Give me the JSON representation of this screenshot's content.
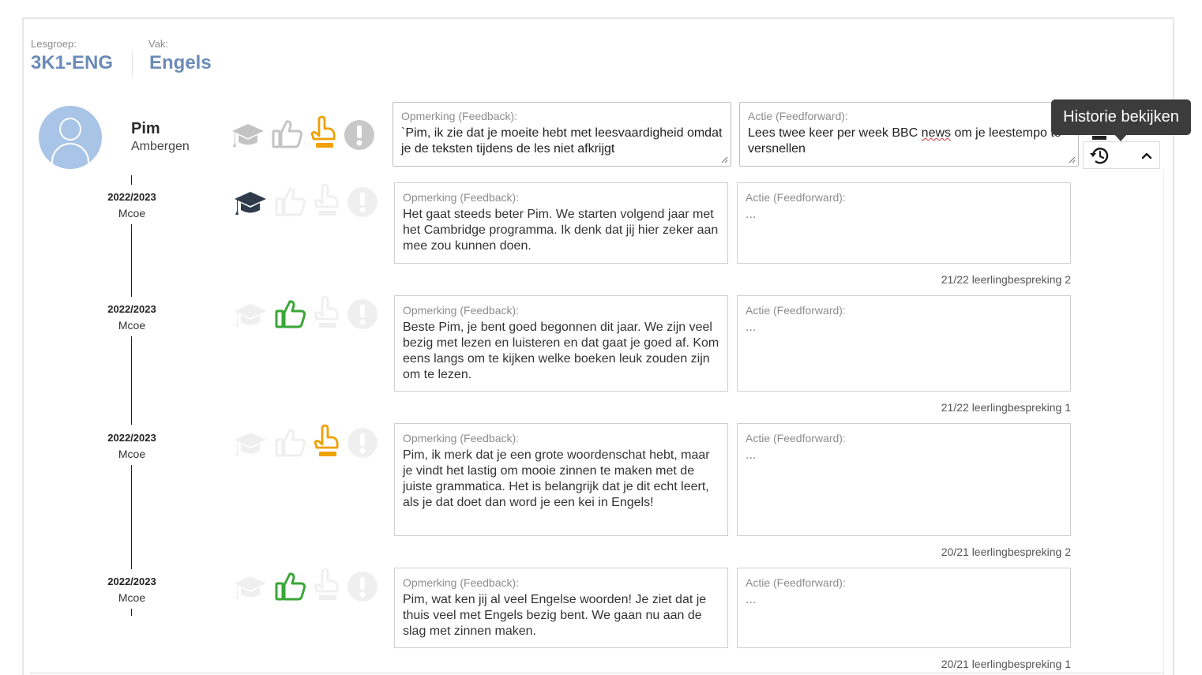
{
  "header": {
    "group_label": "Lesgroep:",
    "group_value": "3K1-ENG",
    "subject_label": "Vak:",
    "subject_value": "Engels"
  },
  "student": {
    "first_name": "Pim",
    "last_name": "Ambergen"
  },
  "current": {
    "feedback_label": "Opmerking (Feedback):",
    "feedback_text": "`Pim, ik zie dat je moeite hebt met leesvaardigheid omdat je de teksten tijdens de les niet afkrijgt",
    "feedforward_label": "Actie (Feedforward):",
    "feedforward_pre": "Lees twee keer per week BBC ",
    "feedforward_misspelled": "news",
    "feedforward_post": " om je leestempo te versnellen",
    "selected_status": "attention",
    "status_color": "#f0a000"
  },
  "tooltip": {
    "text": "Historie bekijken"
  },
  "actions": {
    "history_icon": "history-icon",
    "collapse_icon": "chevron-up-icon"
  },
  "history": [
    {
      "year": "2022/2023",
      "teacher": "Mcoe",
      "status": "excellent",
      "feedback_label": "Opmerking (Feedback):",
      "feedback_text": "Het gaat steeds beter Pim. We starten volgend jaar met het Cambridge programma. Ik denk dat jij hier zeker aan mee zou kunnen doen.",
      "feedforward_label": "Actie (Feedforward):",
      "feedforward_text": "...",
      "meeting": "21/22 leerlingbespreking 2"
    },
    {
      "year": "2022/2023",
      "teacher": "Mcoe",
      "status": "good",
      "feedback_label": "Opmerking (Feedback):",
      "feedback_text": "Beste Pim, je bent goed begonnen dit jaar. We zijn veel bezig met lezen en luisteren en dat gaat je goed af. Kom eens langs om te kijken welke boeken leuk zouden zijn om te lezen.",
      "feedforward_label": "Actie (Feedforward):",
      "feedforward_text": "...",
      "meeting": "21/22 leerlingbespreking 1"
    },
    {
      "year": "2022/2023",
      "teacher": "Mcoe",
      "status": "attention",
      "feedback_label": "Opmerking (Feedback):",
      "feedback_text": "Pim, ik merk dat je een grote woordenschat hebt, maar je vindt het lastig om mooie zinnen te maken met de juiste grammatica. Het is belangrijk dat je dit echt leert, als je dat doet dan word je een kei in Engels!",
      "feedforward_label": "Actie (Feedforward):",
      "feedforward_text": "...",
      "meeting": "20/21 leerlingbespreking 2"
    },
    {
      "year": "2022/2023",
      "teacher": "Mcoe",
      "status": "good",
      "feedback_label": "Opmerking (Feedback):",
      "feedback_text": "Pim, wat ken jij al veel Engelse woorden! Je ziet dat je thuis veel met Engels bezig bent. We gaan nu aan de slag met zinnen maken.",
      "feedforward_label": "Actie (Feedforward):",
      "feedforward_text": "...",
      "meeting": "20/21 leerlingbespreking 1"
    }
  ],
  "colors": {
    "accent_blue": "#6b8bb8",
    "good_green": "#3aa636",
    "attention_orange": "#f0a000",
    "excellent_dark": "#2f3a4a",
    "inactive_gray": "#c8c8c8",
    "faded_gray": "#ececec"
  }
}
